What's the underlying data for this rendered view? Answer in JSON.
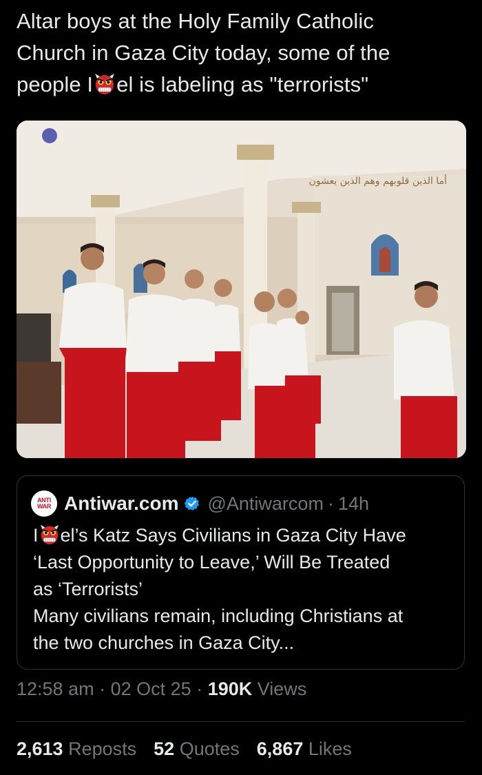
{
  "post": {
    "text_line1": "Altar boys at the Holy Family Catholic",
    "text_line2": "Church in Gaza City today, some of the",
    "text_line3_before": "people I",
    "text_line3_after": "el is labeling as \"terrorists\"",
    "emoji_icon": "ogre-demon-emoji",
    "photo_caption_arabic": "أما الذين قلوبهم وهم الذين يعشون"
  },
  "quote": {
    "avatar_text_line1": "ANTI",
    "avatar_text_line2": "WAR",
    "author_name": "Antiwar.com",
    "handle": "@Antiwarcom",
    "separator": "·",
    "time": "14h",
    "headline_prefix": "I",
    "headline_line1_rest": "el’s Katz Says Civilians in Gaza City Have",
    "headline_line2": "‘Last Opportunity to Leave,’ Will Be Treated",
    "headline_line3": "as ‘Terrorists’",
    "summary_line1": "Many civilians remain, including Christians at",
    "summary_line2": "the two churches in Gaza City..."
  },
  "meta": {
    "time": "12:58 am",
    "sep1": "·",
    "date": "02 Oct 25",
    "sep2": "·",
    "views_count": "190K",
    "views_label": "Views"
  },
  "stats": {
    "reposts_count": "2,613",
    "reposts_label": "Reposts",
    "quotes_count": "52",
    "quotes_label": "Quotes",
    "likes_count": "6,867",
    "likes_label": "Likes"
  },
  "colors": {
    "background": "#000000",
    "text": "#e7e9ea",
    "secondary": "#71767b",
    "border": "#2f3336",
    "verified": "#1d9bf0",
    "robe_red": "#c8141c"
  }
}
